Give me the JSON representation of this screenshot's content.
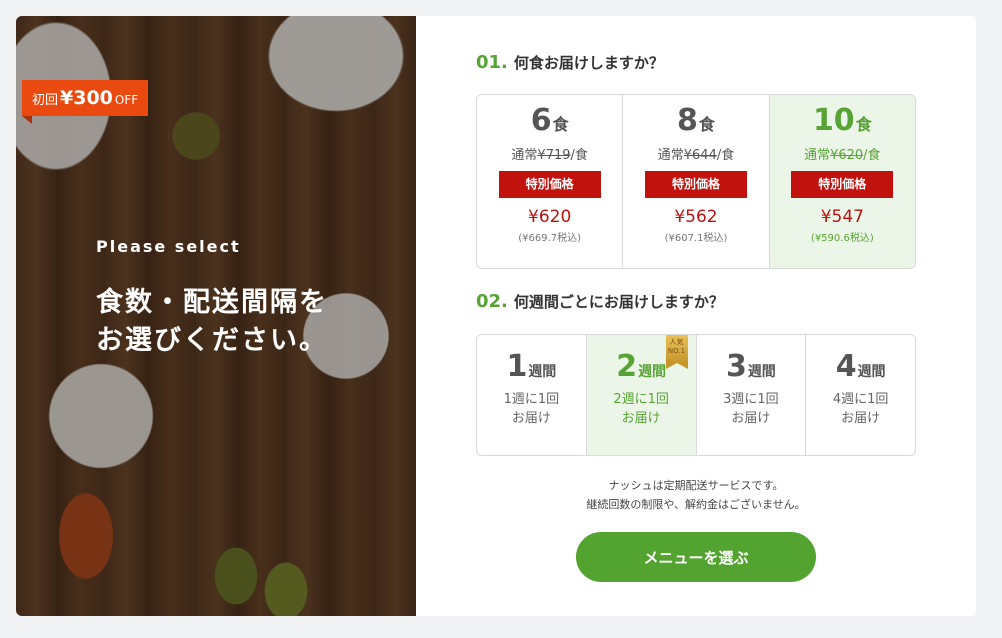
{
  "promo": {
    "prefix": "初回",
    "amount": "¥300",
    "suffix": "OFF"
  },
  "hero": {
    "subtitle": "Please select",
    "title_line1": "食数・配送間隔を",
    "title_line2": "お選びください。"
  },
  "step1": {
    "num": "01.",
    "title": "何食お届けしますか？",
    "options": [
      {
        "count": "6",
        "unit": "食",
        "regular_prefix": "通常",
        "regular_price": "¥719",
        "regular_suffix": "/食",
        "special_label": "特別価格",
        "price": "¥620",
        "tax": "(¥669.7税込)",
        "selected": false
      },
      {
        "count": "8",
        "unit": "食",
        "regular_prefix": "通常",
        "regular_price": "¥644",
        "regular_suffix": "/食",
        "special_label": "特別価格",
        "price": "¥562",
        "tax": "(¥607.1税込)",
        "selected": false
      },
      {
        "count": "10",
        "unit": "食",
        "regular_prefix": "通常",
        "regular_price": "¥620",
        "regular_suffix": "/食",
        "special_label": "特別価格",
        "price": "¥547",
        "tax": "(¥590.6税込)",
        "selected": true
      }
    ]
  },
  "step2": {
    "num": "02.",
    "title": "何週間ごとにお届けしますか？",
    "popular_badge": {
      "line1": "人気",
      "line2": "NO.1"
    },
    "options": [
      {
        "count": "1",
        "unit": "週間",
        "line1": "1週に1回",
        "line2": "お届け",
        "selected": false
      },
      {
        "count": "2",
        "unit": "週間",
        "line1": "2週に1回",
        "line2": "お届け",
        "selected": true
      },
      {
        "count": "3",
        "unit": "週間",
        "line1": "3週に1回",
        "line2": "お届け",
        "selected": false
      },
      {
        "count": "4",
        "unit": "週間",
        "line1": "4週に1回",
        "line2": "お届け",
        "selected": false
      }
    ]
  },
  "note": {
    "line1": "ナッシュは定期配送サービスです。",
    "line2": "継続回数の制限や、解約金はございません。"
  },
  "cta": {
    "label": "メニューを選ぶ"
  },
  "colors": {
    "accent_green": "#52a330",
    "special_red": "#c1120e",
    "price_red": "#b81310",
    "promo_orange": "#ea4a0f",
    "selected_bg": "#ecf6e8"
  }
}
